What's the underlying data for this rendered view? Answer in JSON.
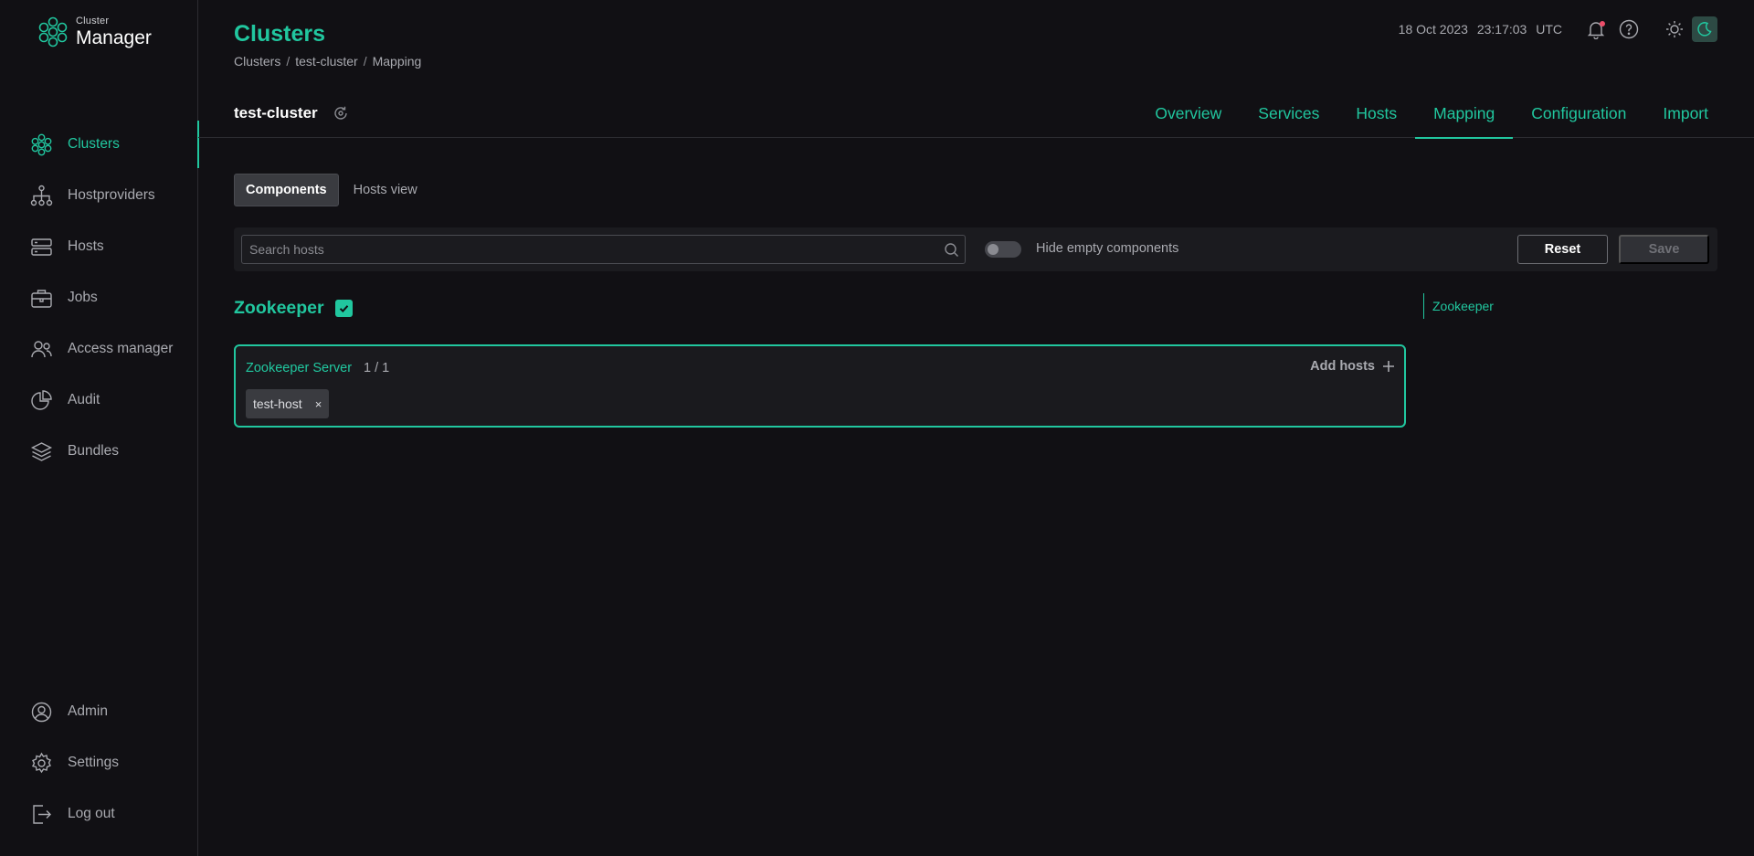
{
  "app": {
    "logo_small": "Cluster",
    "logo_big": "Manager"
  },
  "sidebar": {
    "items": [
      {
        "label": "Clusters",
        "icon": "clusters-icon",
        "active": true
      },
      {
        "label": "Hostproviders",
        "icon": "hostproviders-icon",
        "active": false
      },
      {
        "label": "Hosts",
        "icon": "hosts-icon",
        "active": false
      },
      {
        "label": "Jobs",
        "icon": "jobs-icon",
        "active": false
      },
      {
        "label": "Access manager",
        "icon": "access-manager-icon",
        "active": false
      },
      {
        "label": "Audit",
        "icon": "audit-icon",
        "active": false
      },
      {
        "label": "Bundles",
        "icon": "bundles-icon",
        "active": false
      }
    ],
    "bottom_items": [
      {
        "label": "Admin",
        "icon": "admin-icon"
      },
      {
        "label": "Settings",
        "icon": "settings-icon"
      },
      {
        "label": "Log out",
        "icon": "logout-icon"
      }
    ]
  },
  "header": {
    "title": "Clusters",
    "breadcrumb": [
      "Clusters",
      "test-cluster",
      "Mapping"
    ],
    "separator": "/",
    "date": "18 Oct 2023",
    "time": "23:17:03",
    "timezone": "UTC"
  },
  "cluster": {
    "name": "test-cluster",
    "tabs": [
      {
        "label": "Overview",
        "active": false
      },
      {
        "label": "Services",
        "active": false
      },
      {
        "label": "Hosts",
        "active": false
      },
      {
        "label": "Mapping",
        "active": true
      },
      {
        "label": "Configuration",
        "active": false
      },
      {
        "label": "Import",
        "active": false
      }
    ]
  },
  "view_toggle": {
    "components_label": "Components",
    "hosts_view_label": "Hosts view",
    "selected": "Components"
  },
  "toolbar": {
    "search_placeholder": "Search hosts",
    "search_value": "",
    "hide_empty_label": "Hide empty components",
    "hide_empty_on": false,
    "reset_label": "Reset",
    "save_label": "Save"
  },
  "mapping": {
    "service": {
      "name": "Zookeeper",
      "checked": true,
      "components": [
        {
          "name": "Zookeeper Server",
          "count": "1 / 1",
          "add_label": "Add hosts",
          "hosts": [
            "test-host"
          ]
        }
      ]
    },
    "anchor_nav": [
      "Zookeeper"
    ]
  },
  "colors": {
    "accent": "#21c79f",
    "background": "#111014",
    "panel": "#1b1b1f",
    "notification_dot": "#ee4e6a"
  }
}
